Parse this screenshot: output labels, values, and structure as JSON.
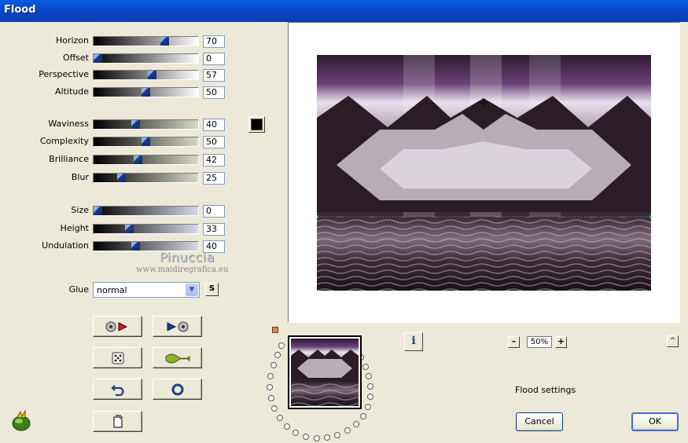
{
  "window": {
    "title": "Flood"
  },
  "sliders": [
    {
      "id": "horizon",
      "label": "Horizon",
      "value": "70",
      "level": 0.7
    },
    {
      "id": "offset",
      "label": "Offset",
      "value": "0",
      "level": 0.0
    },
    {
      "id": "perspective",
      "label": "Perspective",
      "value": "57",
      "level": 0.57
    },
    {
      "id": "altitude",
      "label": "Altitude",
      "value": "50",
      "level": 0.5
    },
    {
      "id": "waviness",
      "label": "Waviness",
      "value": "40",
      "level": 0.4
    },
    {
      "id": "complexity",
      "label": "Complexity",
      "value": "50",
      "level": 0.5
    },
    {
      "id": "brilliance",
      "label": "Brilliance",
      "value": "42",
      "level": 0.42
    },
    {
      "id": "blur",
      "label": "Blur",
      "value": "25",
      "level": 0.25
    },
    {
      "id": "size",
      "label": "Size",
      "value": "0",
      "level": 0.0
    },
    {
      "id": "height",
      "label": "Height",
      "value": "33",
      "level": 0.33
    },
    {
      "id": "undulation",
      "label": "Undulation",
      "value": "40",
      "level": 0.4
    }
  ],
  "color_swatch": "#000000",
  "glue": {
    "label": "Glue",
    "value": "normal",
    "lock_label": "S"
  },
  "watermark": {
    "name": "Pinuccia",
    "url": "www.maidiregrafica.eu"
  },
  "zoom": {
    "minus": "–",
    "value": "50%",
    "plus": "+"
  },
  "status": "Flood settings",
  "buttons": {
    "cancel": "Cancel",
    "ok": "OK",
    "info": "i",
    "collapse": "^"
  },
  "colors": {
    "accent": "#0a5be0",
    "dialog_bg": "#ece9d8",
    "horizon_line": "#00cc33"
  }
}
